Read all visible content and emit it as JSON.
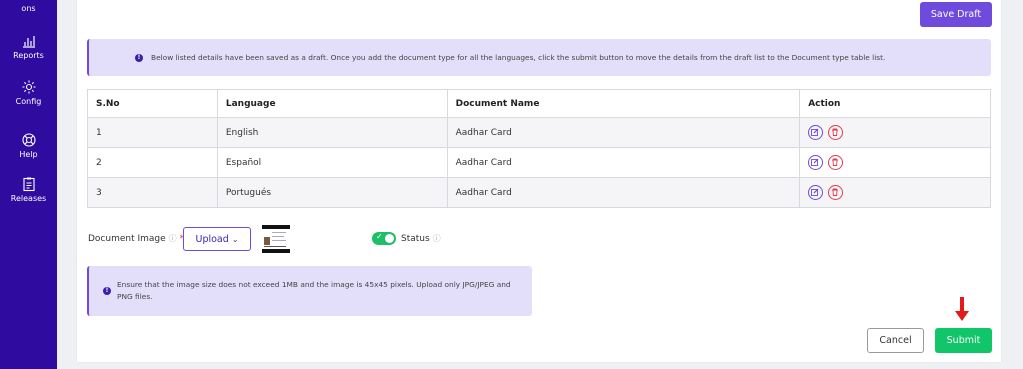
{
  "sidebar": {
    "items": [
      {
        "label": "ons",
        "icon": "partial-item-icon"
      },
      {
        "label": "Reports",
        "icon": "bar-chart-icon"
      },
      {
        "label": "Config",
        "icon": "gear-icon"
      },
      {
        "label": "Help",
        "icon": "lifebuoy-icon"
      },
      {
        "label": "Releases",
        "icon": "clipboard-icon"
      }
    ]
  },
  "header": {
    "save_draft_label": "Save Draft"
  },
  "info_banner": {
    "text": "Below listed details have been saved as a draft. Once you add the document type for all the languages, click the submit button to move the details from the draft list to the Document type table list."
  },
  "table": {
    "headers": [
      "S.No",
      "Language",
      "Document Name",
      "Action"
    ],
    "rows": [
      {
        "sno": "1",
        "language": "English",
        "document_name": "Aadhar Card"
      },
      {
        "sno": "2",
        "language": "Español",
        "document_name": "Aadhar Card"
      },
      {
        "sno": "3",
        "language": "Portugués",
        "document_name": "Aadhar Card"
      }
    ]
  },
  "form": {
    "document_image_label": "Document Image",
    "required_mark": "*",
    "colon": ":",
    "upload_label": "Upload",
    "status_label": "Status",
    "status_on": true
  },
  "note_banner": {
    "text": "Ensure that the image size does not exceed 1MB and the image is 45x45 pixels. Upload only JPG/JPEG and PNG files."
  },
  "footer": {
    "cancel_label": "Cancel",
    "submit_label": "Submit"
  },
  "colors": {
    "sidebar": "#2f0ba0",
    "accent": "#6e4bdc",
    "submit": "#10c56a",
    "danger": "#e53950",
    "arrow": "#e21a1a"
  }
}
